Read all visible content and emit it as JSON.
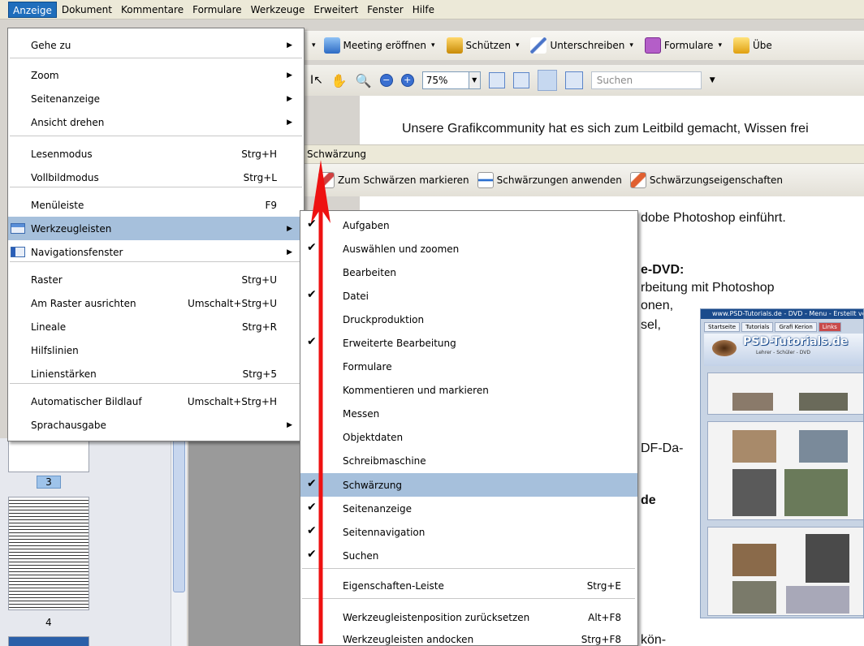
{
  "menubar": {
    "items": [
      "Anzeige",
      "Dokument",
      "Kommentare",
      "Formulare",
      "Werkzeuge",
      "Erweitert",
      "Fenster",
      "Hilfe"
    ],
    "active_index": 0
  },
  "toolbar1": {
    "meeting": "Meeting eröffnen",
    "schuetzen": "Schützen",
    "unterschreiben": "Unterschreiben",
    "formulare": "Formulare",
    "ueber": "Übe"
  },
  "toolbar2": {
    "zoom_value": "75%",
    "search_placeholder": "Suchen"
  },
  "schwaerzung_toolbar": {
    "title": "Schwärzung",
    "mark": "Zum Schwärzen markieren",
    "apply": "Schwärzungen anwenden",
    "props": "Schwärzungseigenschaften"
  },
  "anzeige_menu": {
    "items": [
      {
        "label": "Gehe zu",
        "shortcut": "",
        "submenu": true
      },
      {
        "label": "Zoom",
        "shortcut": "",
        "submenu": true
      },
      {
        "label": "Seitenanzeige",
        "shortcut": "",
        "submenu": true
      },
      {
        "label": "Ansicht drehen",
        "shortcut": "",
        "submenu": true
      },
      {
        "label": "Lesenmodus",
        "shortcut": "Strg+H",
        "submenu": false
      },
      {
        "label": "Vollbildmodus",
        "shortcut": "Strg+L",
        "submenu": false
      },
      {
        "label": "Menüleiste",
        "shortcut": "F9",
        "submenu": false
      },
      {
        "label": "Werkzeugleisten",
        "shortcut": "",
        "submenu": true
      },
      {
        "label": "Navigationsfenster",
        "shortcut": "",
        "submenu": true
      },
      {
        "label": "Raster",
        "shortcut": "Strg+U",
        "submenu": false
      },
      {
        "label": "Am Raster ausrichten",
        "shortcut": "Umschalt+Strg+U",
        "submenu": false
      },
      {
        "label": "Lineale",
        "shortcut": "Strg+R",
        "submenu": false
      },
      {
        "label": "Hilfslinien",
        "shortcut": "",
        "submenu": false
      },
      {
        "label": "Linienstärken",
        "shortcut": "Strg+5",
        "submenu": false
      },
      {
        "label": "Automatischer Bildlauf",
        "shortcut": "Umschalt+Strg+H",
        "submenu": false
      },
      {
        "label": "Sprachausgabe",
        "shortcut": "",
        "submenu": true
      }
    ],
    "highlighted_index": 7
  },
  "werkzeug_menu": {
    "items": [
      {
        "label": "Aufgaben",
        "shortcut": "",
        "checked": true
      },
      {
        "label": "Auswählen und zoomen",
        "shortcut": "",
        "checked": true
      },
      {
        "label": "Bearbeiten",
        "shortcut": "",
        "checked": false
      },
      {
        "label": "Datei",
        "shortcut": "",
        "checked": true
      },
      {
        "label": "Druckproduktion",
        "shortcut": "",
        "checked": false
      },
      {
        "label": "Erweiterte Bearbeitung",
        "shortcut": "",
        "checked": true
      },
      {
        "label": "Formulare",
        "shortcut": "",
        "checked": false
      },
      {
        "label": "Kommentieren und markieren",
        "shortcut": "",
        "checked": false
      },
      {
        "label": "Messen",
        "shortcut": "",
        "checked": false
      },
      {
        "label": "Objektdaten",
        "shortcut": "",
        "checked": false
      },
      {
        "label": "Schreibmaschine",
        "shortcut": "",
        "checked": false
      },
      {
        "label": "Schwärzung",
        "shortcut": "",
        "checked": true
      },
      {
        "label": "Seitenanzeige",
        "shortcut": "",
        "checked": true
      },
      {
        "label": "Seitennavigation",
        "shortcut": "",
        "checked": true
      },
      {
        "label": "Suchen",
        "shortcut": "",
        "checked": true
      },
      {
        "label": "Eigenschaften-Leiste",
        "shortcut": "Strg+E",
        "checked": false
      },
      {
        "label": "Werkzeugleistenposition zurücksetzen",
        "shortcut": "Alt+F8",
        "checked": false
      },
      {
        "label": "Werkzeugleisten andocken",
        "shortcut": "Strg+F8",
        "checked": false
      }
    ],
    "highlighted_index": 11
  },
  "document": {
    "line1": "Unsere Grafikcommunity hat es sich zum Leitbild gemacht, Wissen frei",
    "line2": "dobe Photoshop einführt.",
    "line3": "e-DVD:",
    "line4": "rbeitung mit Photoshop",
    "line5": "onen,",
    "line6": "sel,",
    "line7": "DF-Da-",
    "line8": "de",
    "line9": "kön-"
  },
  "thumbnails": {
    "page_selected": "3",
    "page_next": "4"
  },
  "preview": {
    "header": "www.PSD-Tutorials.de - DVD - Menu - Erstellt von Stefan Petri",
    "tabs": [
      "Startseite",
      "Tutorials",
      "Grafi Kerion",
      "Links"
    ],
    "logo": "PSD-Tutorials.de",
    "sub": "Lehrer - Schüler - DVD"
  }
}
